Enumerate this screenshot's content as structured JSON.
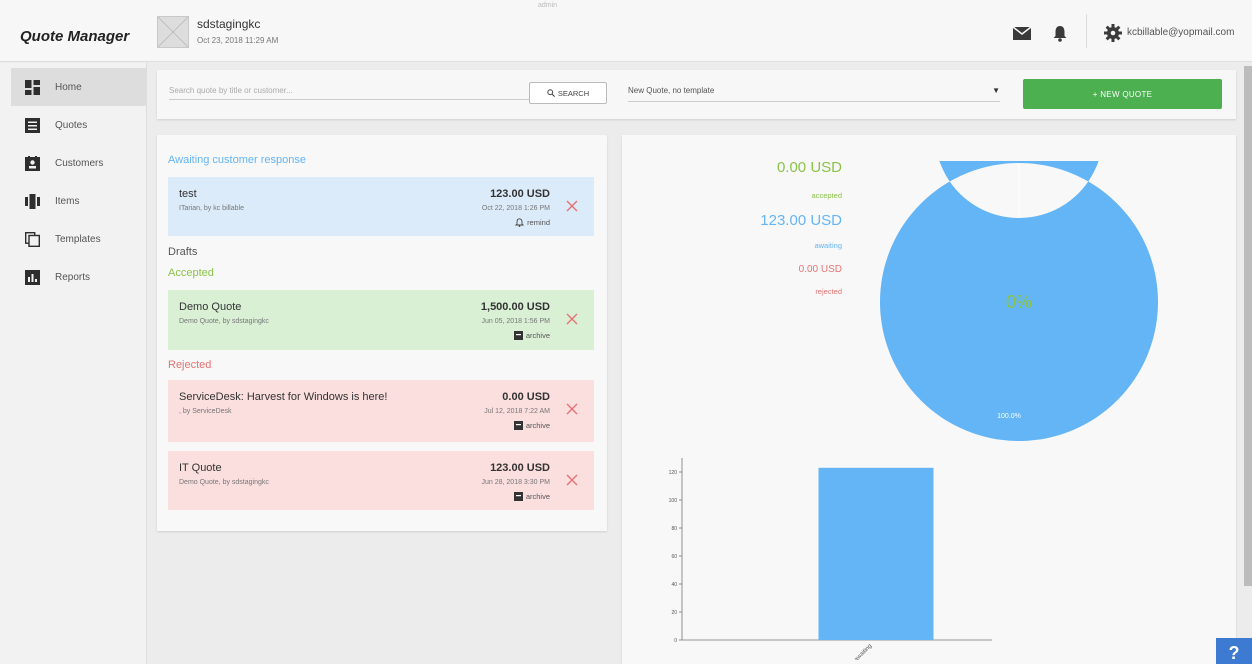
{
  "app": {
    "title": "Quote Manager"
  },
  "header": {
    "company_name": "sdstagingkc",
    "company_date": "Oct 23, 2018 11:29 AM",
    "top_mark": "admin",
    "user_email": "kcbillable@yopmail.com"
  },
  "sidebar": {
    "items": [
      {
        "label": "Home",
        "icon": "home-icon",
        "active": true
      },
      {
        "label": "Quotes",
        "icon": "quotes-icon",
        "active": false
      },
      {
        "label": "Customers",
        "icon": "customers-icon",
        "active": false
      },
      {
        "label": "Items",
        "icon": "items-icon",
        "active": false
      },
      {
        "label": "Templates",
        "icon": "templates-icon",
        "active": false
      },
      {
        "label": "Reports",
        "icon": "reports-icon",
        "active": false
      }
    ]
  },
  "search": {
    "placeholder": "Search quote by title or customer...",
    "button_label": "SEARCH",
    "template_select": "New Quote, no template",
    "new_quote_label": "+ NEW QUOTE"
  },
  "sections": {
    "awaiting": "Awaiting customer response",
    "drafts": "Drafts",
    "accepted": "Accepted",
    "rejected": "Rejected"
  },
  "quotes": [
    {
      "title": "test",
      "sub": "ITarian, by kc billable",
      "amount": "123.00 USD",
      "date": "Oct 22, 2018 1:26 PM",
      "action": "remind",
      "status": "awaiting"
    },
    {
      "title": "Demo Quote",
      "sub": "Demo Quote, by sdstagingkc",
      "amount": "1,500.00 USD",
      "date": "Jun 05, 2018 1:56 PM",
      "action": "archive",
      "status": "accepted"
    },
    {
      "title": "ServiceDesk: Harvest for Windows is here!",
      "sub": ", by ServiceDesk",
      "amount": "0.00 USD",
      "date": "Jul 12, 2018 7:22 AM",
      "action": "archive",
      "status": "rejected"
    },
    {
      "title": "IT Quote",
      "sub": "Demo Quote, by sdstagingkc",
      "amount": "123.00 USD",
      "date": "Jun 28, 2018 3:30 PM",
      "action": "archive",
      "status": "rejected"
    }
  ],
  "summary": {
    "accepted_amount": "0.00 USD",
    "accepted_label": "accepted",
    "awaiting_amount": "123.00 USD",
    "awaiting_label": "awaiting",
    "rejected_amount": "0.00 USD",
    "rejected_label": "rejected"
  },
  "colors": {
    "accepted": "#8bc34a",
    "awaiting": "#64b5f6",
    "rejected": "#e57373",
    "awaiting_bg": "#dcebf9",
    "accepted_bg": "#d9f0d5",
    "rejected_bg": "#fbdede",
    "primary_button": "#4caf50"
  },
  "chart_data": [
    {
      "type": "pie",
      "title": "",
      "center_label": "0%",
      "categories": [
        "awaiting",
        "accepted"
      ],
      "values": [
        100.0,
        0.0
      ],
      "data_labels": [
        "100.0%",
        "0%"
      ]
    },
    {
      "type": "bar",
      "title": "",
      "categories": [
        "awaiting"
      ],
      "values": [
        123
      ],
      "xlabel": "",
      "ylabel": "",
      "ylim": [
        0,
        130
      ],
      "yticks": [
        0,
        20,
        40,
        60,
        80,
        100,
        120
      ]
    }
  ]
}
